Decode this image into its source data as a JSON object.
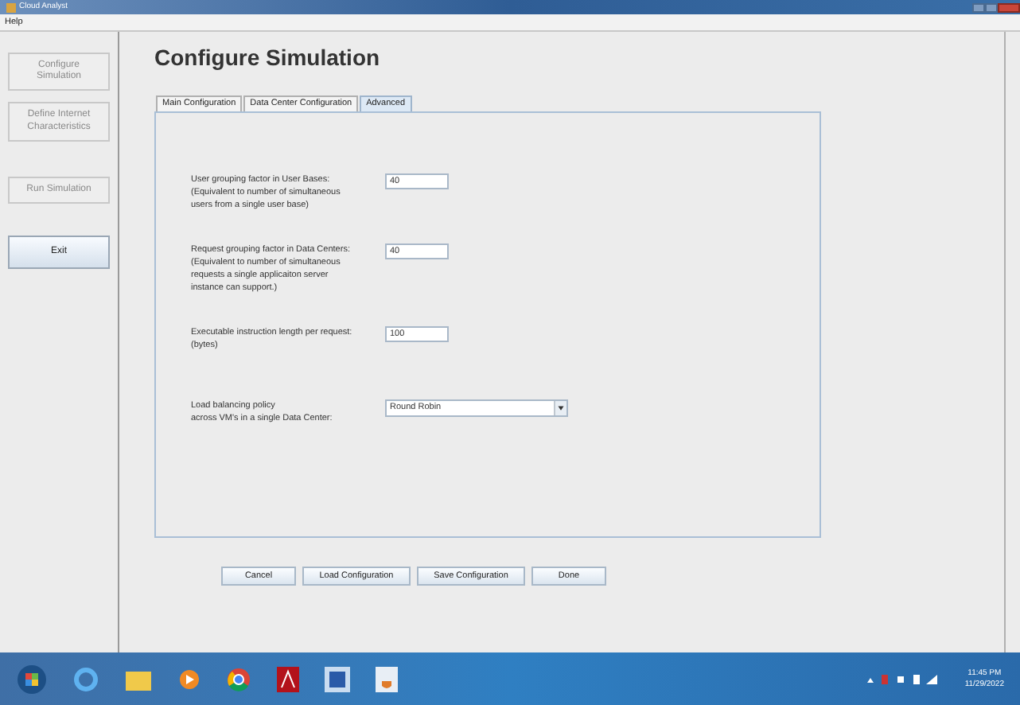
{
  "window": {
    "title": "Cloud Analyst"
  },
  "menu": [
    "Help"
  ],
  "sidebar": [
    {
      "label": "Configure Simulation",
      "disabled": true
    },
    {
      "label": "Define Internet Characteristics",
      "disabled": true
    },
    {
      "label": "Run Simulation",
      "disabled": true
    },
    {
      "label": "Exit",
      "disabled": false
    }
  ],
  "heading": "Configure Simulation",
  "tabs": [
    {
      "label": "Main Configuration",
      "selected": false
    },
    {
      "label": "Data Center Configuration",
      "selected": false
    },
    {
      "label": "Advanced",
      "selected": true
    }
  ],
  "settings": [
    {
      "kind": "text",
      "label": [
        "User grouping factor in User Bases:",
        "(Equivalent to number of simultaneous",
        "users from a single user base)"
      ],
      "value": "40"
    },
    {
      "kind": "text",
      "label": [
        "Request grouping factor in Data Centers:",
        "(Equivalent to number of simultaneous",
        "requests a single applicaiton server",
        "instance can support.)"
      ],
      "value": "40"
    },
    {
      "kind": "text",
      "label": [
        "Executable instruction length per request:",
        "(bytes)"
      ],
      "value": "100"
    },
    {
      "kind": "select",
      "label": [
        "Load balancing policy",
        "across VM's in a single Data Center:"
      ],
      "value": "Round Robin"
    }
  ],
  "buttons": [
    "Cancel",
    "Load Configuration",
    "Save Configuration",
    "Done"
  ],
  "taskbar": {
    "time": "11:45 PM",
    "date": "11/29/2022"
  }
}
